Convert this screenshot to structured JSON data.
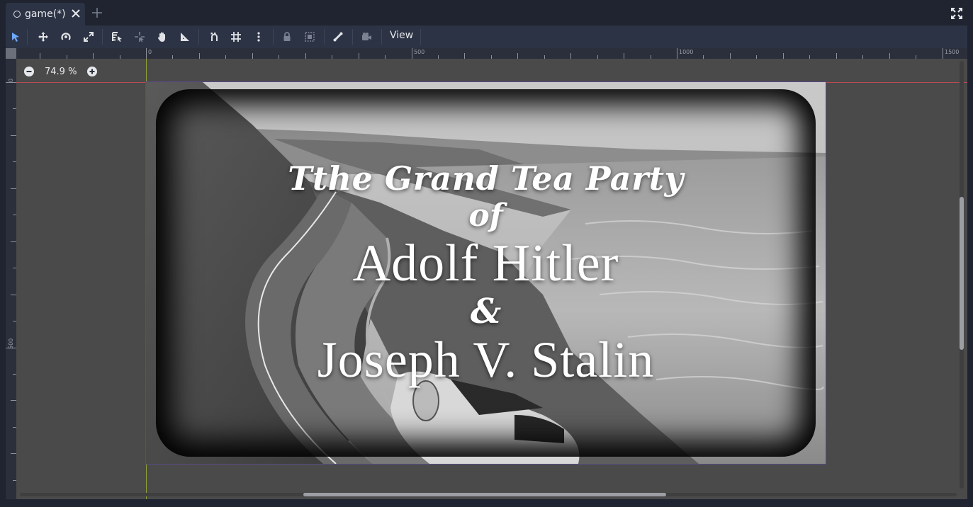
{
  "tabs": [
    {
      "label": "game(*)",
      "active": true
    }
  ],
  "toolbar": {
    "tools": [
      "select-tool",
      "move-tool",
      "rotate-tool",
      "scale-tool",
      "list-select-tool",
      "pivot-tool",
      "pan-tool",
      "ruler-tool",
      "smart-snap-toggle",
      "grid-snap-toggle",
      "snap-options-menu",
      "lock-toggle",
      "group-toggle",
      "skeleton-tool",
      "camera-override-tool"
    ],
    "view_label": "View"
  },
  "zoom": {
    "label": "74.9 %"
  },
  "rulers": {
    "top_labels": [
      "0",
      "500",
      "1000",
      "1500"
    ],
    "left_labels": [
      "0",
      "500"
    ]
  },
  "scene": {
    "title_line1": "Tthe Grand Tea Party",
    "title_line2": "of",
    "title_line3": "Adolf Hitler",
    "title_line4": "&",
    "title_line5": "Joseph V. Stalin"
  },
  "colors": {
    "editor_bg": "#1f2430",
    "panel_bg": "#2c3344",
    "viewport_bg": "#4a4a4a",
    "accent_select": "#6ea7ff",
    "guide_vertical": "#a0b832",
    "guide_horizontal": "#c84a5a"
  },
  "scrollbars": {
    "vertical_position": 0.32,
    "horizontal_position": 0.3
  }
}
